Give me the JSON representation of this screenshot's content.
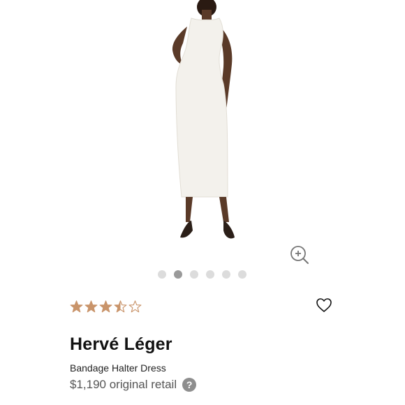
{
  "product": {
    "brand": "Hervé Léger",
    "name": "Bandage Halter Dress",
    "price": "$1,190 original retail",
    "rating": 3.5,
    "rating_max": 5,
    "help_glyph": "?"
  },
  "gallery": {
    "image_count": 6,
    "active_index": 1
  },
  "colors": {
    "star": "#c9946a",
    "dot_active": "#9a9a9a",
    "dot_inactive": "#dcdcdc",
    "dress": "#f3f1ec"
  },
  "icons": {
    "zoom": "zoom-in-icon",
    "wishlist": "heart-icon",
    "help": "question-icon"
  }
}
